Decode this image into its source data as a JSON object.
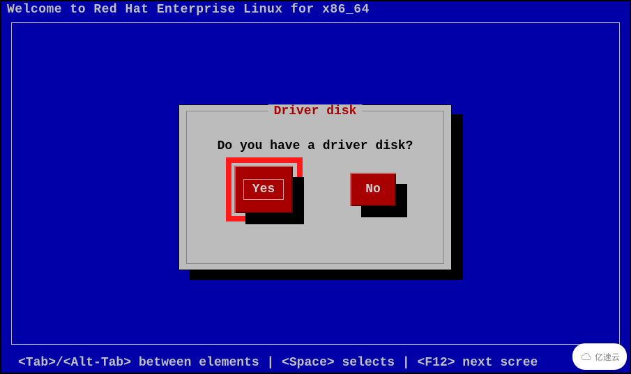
{
  "title": "Welcome to Red Hat Enterprise Linux for x86_64",
  "dialog": {
    "title": "Driver disk",
    "prompt": "Do you have a driver disk?",
    "yes_label": "Yes",
    "no_label": "No"
  },
  "status": "<Tab>/<Alt-Tab> between elements  | <Space> selects | <F12> next scree",
  "watermark": "亿速云"
}
